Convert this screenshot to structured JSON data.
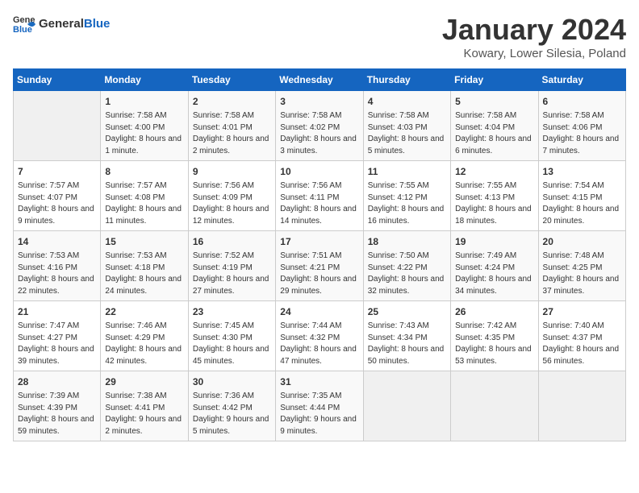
{
  "logo": {
    "general": "General",
    "blue": "Blue"
  },
  "header": {
    "month": "January 2024",
    "location": "Kowary, Lower Silesia, Poland"
  },
  "weekdays": [
    "Sunday",
    "Monday",
    "Tuesday",
    "Wednesday",
    "Thursday",
    "Friday",
    "Saturday"
  ],
  "weeks": [
    [
      {
        "day": "",
        "sunrise": "",
        "sunset": "",
        "daylight": ""
      },
      {
        "day": "1",
        "sunrise": "Sunrise: 7:58 AM",
        "sunset": "Sunset: 4:00 PM",
        "daylight": "Daylight: 8 hours and 1 minute."
      },
      {
        "day": "2",
        "sunrise": "Sunrise: 7:58 AM",
        "sunset": "Sunset: 4:01 PM",
        "daylight": "Daylight: 8 hours and 2 minutes."
      },
      {
        "day": "3",
        "sunrise": "Sunrise: 7:58 AM",
        "sunset": "Sunset: 4:02 PM",
        "daylight": "Daylight: 8 hours and 3 minutes."
      },
      {
        "day": "4",
        "sunrise": "Sunrise: 7:58 AM",
        "sunset": "Sunset: 4:03 PM",
        "daylight": "Daylight: 8 hours and 5 minutes."
      },
      {
        "day": "5",
        "sunrise": "Sunrise: 7:58 AM",
        "sunset": "Sunset: 4:04 PM",
        "daylight": "Daylight: 8 hours and 6 minutes."
      },
      {
        "day": "6",
        "sunrise": "Sunrise: 7:58 AM",
        "sunset": "Sunset: 4:06 PM",
        "daylight": "Daylight: 8 hours and 7 minutes."
      }
    ],
    [
      {
        "day": "7",
        "sunrise": "Sunrise: 7:57 AM",
        "sunset": "Sunset: 4:07 PM",
        "daylight": "Daylight: 8 hours and 9 minutes."
      },
      {
        "day": "8",
        "sunrise": "Sunrise: 7:57 AM",
        "sunset": "Sunset: 4:08 PM",
        "daylight": "Daylight: 8 hours and 11 minutes."
      },
      {
        "day": "9",
        "sunrise": "Sunrise: 7:56 AM",
        "sunset": "Sunset: 4:09 PM",
        "daylight": "Daylight: 8 hours and 12 minutes."
      },
      {
        "day": "10",
        "sunrise": "Sunrise: 7:56 AM",
        "sunset": "Sunset: 4:11 PM",
        "daylight": "Daylight: 8 hours and 14 minutes."
      },
      {
        "day": "11",
        "sunrise": "Sunrise: 7:55 AM",
        "sunset": "Sunset: 4:12 PM",
        "daylight": "Daylight: 8 hours and 16 minutes."
      },
      {
        "day": "12",
        "sunrise": "Sunrise: 7:55 AM",
        "sunset": "Sunset: 4:13 PM",
        "daylight": "Daylight: 8 hours and 18 minutes."
      },
      {
        "day": "13",
        "sunrise": "Sunrise: 7:54 AM",
        "sunset": "Sunset: 4:15 PM",
        "daylight": "Daylight: 8 hours and 20 minutes."
      }
    ],
    [
      {
        "day": "14",
        "sunrise": "Sunrise: 7:53 AM",
        "sunset": "Sunset: 4:16 PM",
        "daylight": "Daylight: 8 hours and 22 minutes."
      },
      {
        "day": "15",
        "sunrise": "Sunrise: 7:53 AM",
        "sunset": "Sunset: 4:18 PM",
        "daylight": "Daylight: 8 hours and 24 minutes."
      },
      {
        "day": "16",
        "sunrise": "Sunrise: 7:52 AM",
        "sunset": "Sunset: 4:19 PM",
        "daylight": "Daylight: 8 hours and 27 minutes."
      },
      {
        "day": "17",
        "sunrise": "Sunrise: 7:51 AM",
        "sunset": "Sunset: 4:21 PM",
        "daylight": "Daylight: 8 hours and 29 minutes."
      },
      {
        "day": "18",
        "sunrise": "Sunrise: 7:50 AM",
        "sunset": "Sunset: 4:22 PM",
        "daylight": "Daylight: 8 hours and 32 minutes."
      },
      {
        "day": "19",
        "sunrise": "Sunrise: 7:49 AM",
        "sunset": "Sunset: 4:24 PM",
        "daylight": "Daylight: 8 hours and 34 minutes."
      },
      {
        "day": "20",
        "sunrise": "Sunrise: 7:48 AM",
        "sunset": "Sunset: 4:25 PM",
        "daylight": "Daylight: 8 hours and 37 minutes."
      }
    ],
    [
      {
        "day": "21",
        "sunrise": "Sunrise: 7:47 AM",
        "sunset": "Sunset: 4:27 PM",
        "daylight": "Daylight: 8 hours and 39 minutes."
      },
      {
        "day": "22",
        "sunrise": "Sunrise: 7:46 AM",
        "sunset": "Sunset: 4:29 PM",
        "daylight": "Daylight: 8 hours and 42 minutes."
      },
      {
        "day": "23",
        "sunrise": "Sunrise: 7:45 AM",
        "sunset": "Sunset: 4:30 PM",
        "daylight": "Daylight: 8 hours and 45 minutes."
      },
      {
        "day": "24",
        "sunrise": "Sunrise: 7:44 AM",
        "sunset": "Sunset: 4:32 PM",
        "daylight": "Daylight: 8 hours and 47 minutes."
      },
      {
        "day": "25",
        "sunrise": "Sunrise: 7:43 AM",
        "sunset": "Sunset: 4:34 PM",
        "daylight": "Daylight: 8 hours and 50 minutes."
      },
      {
        "day": "26",
        "sunrise": "Sunrise: 7:42 AM",
        "sunset": "Sunset: 4:35 PM",
        "daylight": "Daylight: 8 hours and 53 minutes."
      },
      {
        "day": "27",
        "sunrise": "Sunrise: 7:40 AM",
        "sunset": "Sunset: 4:37 PM",
        "daylight": "Daylight: 8 hours and 56 minutes."
      }
    ],
    [
      {
        "day": "28",
        "sunrise": "Sunrise: 7:39 AM",
        "sunset": "Sunset: 4:39 PM",
        "daylight": "Daylight: 8 hours and 59 minutes."
      },
      {
        "day": "29",
        "sunrise": "Sunrise: 7:38 AM",
        "sunset": "Sunset: 4:41 PM",
        "daylight": "Daylight: 9 hours and 2 minutes."
      },
      {
        "day": "30",
        "sunrise": "Sunrise: 7:36 AM",
        "sunset": "Sunset: 4:42 PM",
        "daylight": "Daylight: 9 hours and 5 minutes."
      },
      {
        "day": "31",
        "sunrise": "Sunrise: 7:35 AM",
        "sunset": "Sunset: 4:44 PM",
        "daylight": "Daylight: 9 hours and 9 minutes."
      },
      {
        "day": "",
        "sunrise": "",
        "sunset": "",
        "daylight": ""
      },
      {
        "day": "",
        "sunrise": "",
        "sunset": "",
        "daylight": ""
      },
      {
        "day": "",
        "sunrise": "",
        "sunset": "",
        "daylight": ""
      }
    ]
  ]
}
